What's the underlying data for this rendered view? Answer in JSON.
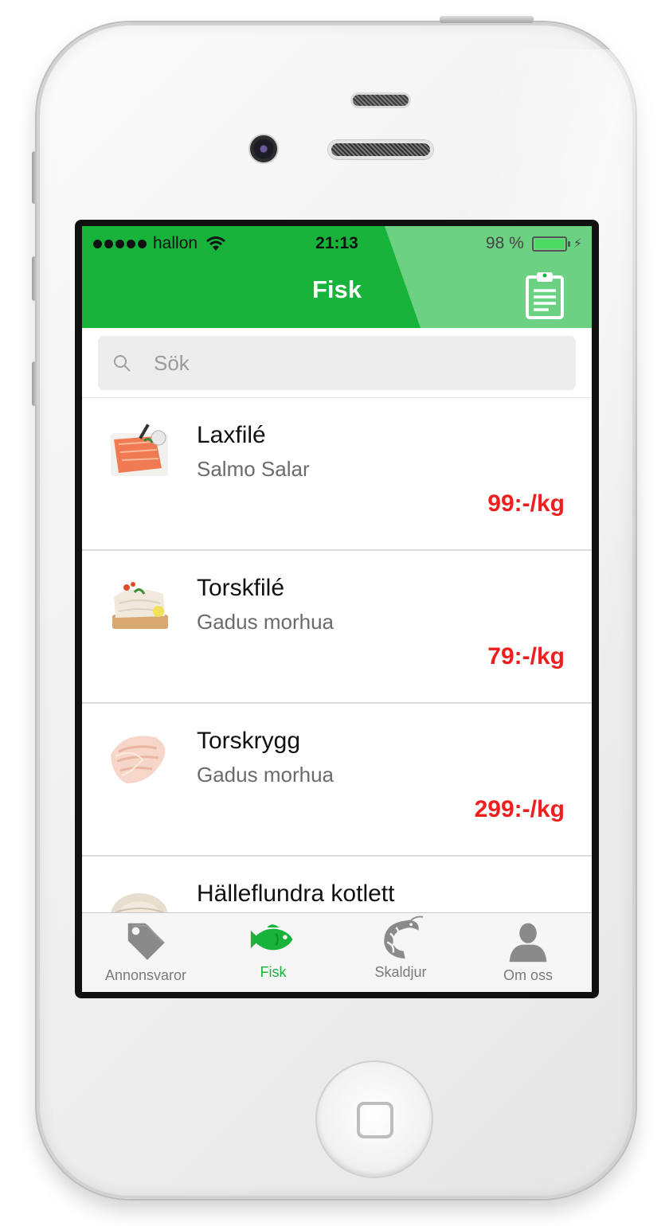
{
  "status_bar": {
    "carrier": "hallon",
    "time": "21:13",
    "battery": "98 %"
  },
  "nav": {
    "title": "Fisk"
  },
  "search": {
    "placeholder": "Sök"
  },
  "products": [
    {
      "name": "Laxfilé",
      "latin": "Salmo Salar",
      "price": "99:-/kg"
    },
    {
      "name": "Torskfilé",
      "latin": "Gadus morhua",
      "price": "79:-/kg"
    },
    {
      "name": "Torskrygg",
      "latin": "Gadus morhua",
      "price": "299:-/kg"
    },
    {
      "name": "Hälleflundra kotlett",
      "latin": "",
      "price": ""
    }
  ],
  "tabs": [
    {
      "label": "Annonsvaror",
      "icon": "tag-icon",
      "active": false
    },
    {
      "label": "Fisk",
      "icon": "fish-icon",
      "active": true
    },
    {
      "label": "Skaldjur",
      "icon": "shrimp-icon",
      "active": false
    },
    {
      "label": "Om oss",
      "icon": "person-icon",
      "active": false
    }
  ],
  "colors": {
    "accent": "#18b33a",
    "price": "#ee1f1f",
    "header_light": "#6dd184"
  }
}
